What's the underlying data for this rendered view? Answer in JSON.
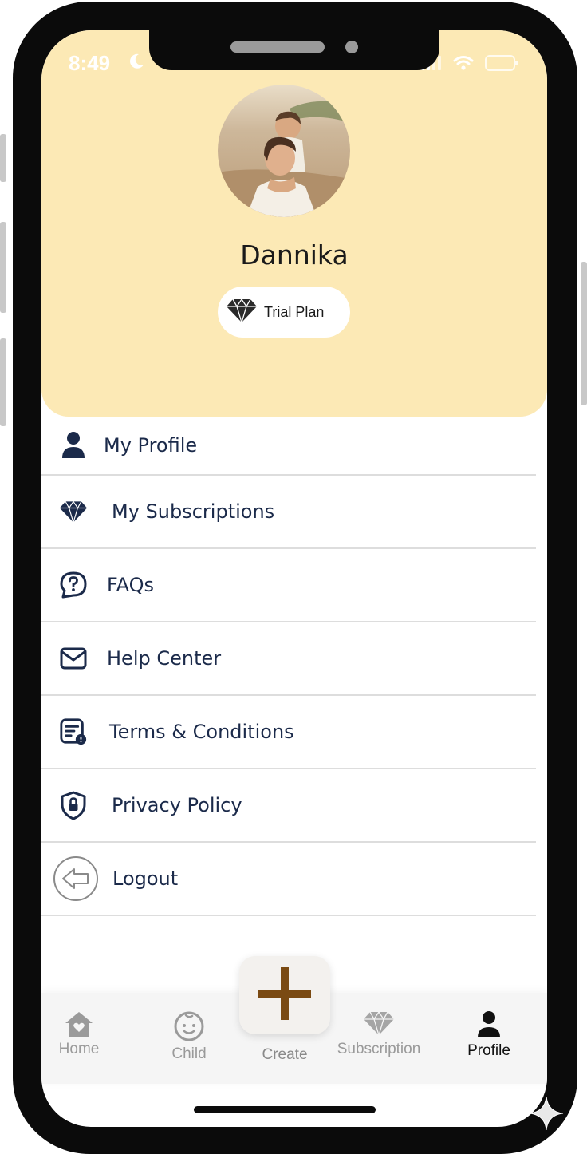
{
  "status_bar": {
    "time": "8:49"
  },
  "profile": {
    "name": "Dannika",
    "plan": "Trial Plan"
  },
  "menu": [
    {
      "label": "My Profile",
      "icon": "person-icon"
    },
    {
      "label": "My Subscriptions",
      "icon": "diamond-icon"
    },
    {
      "label": "FAQs",
      "icon": "question-bubble-icon"
    },
    {
      "label": "Help Center",
      "icon": "envelope-icon"
    },
    {
      "label": "Terms & Conditions",
      "icon": "document-icon"
    },
    {
      "label": "Privacy Policy",
      "icon": "shield-lock-icon"
    },
    {
      "label": "Logout",
      "icon": "logout-arrow-icon"
    }
  ],
  "tabs": {
    "home": "Home",
    "child": "Child",
    "create": "Create",
    "subscription": "Subscription",
    "profile": "Profile"
  },
  "colors": {
    "header_bg": "#fce9b5",
    "menu_text": "#1b2a4a",
    "create_plus": "#7a4a12",
    "inactive_tab": "#9a9a9a",
    "active_tab": "#111111"
  }
}
